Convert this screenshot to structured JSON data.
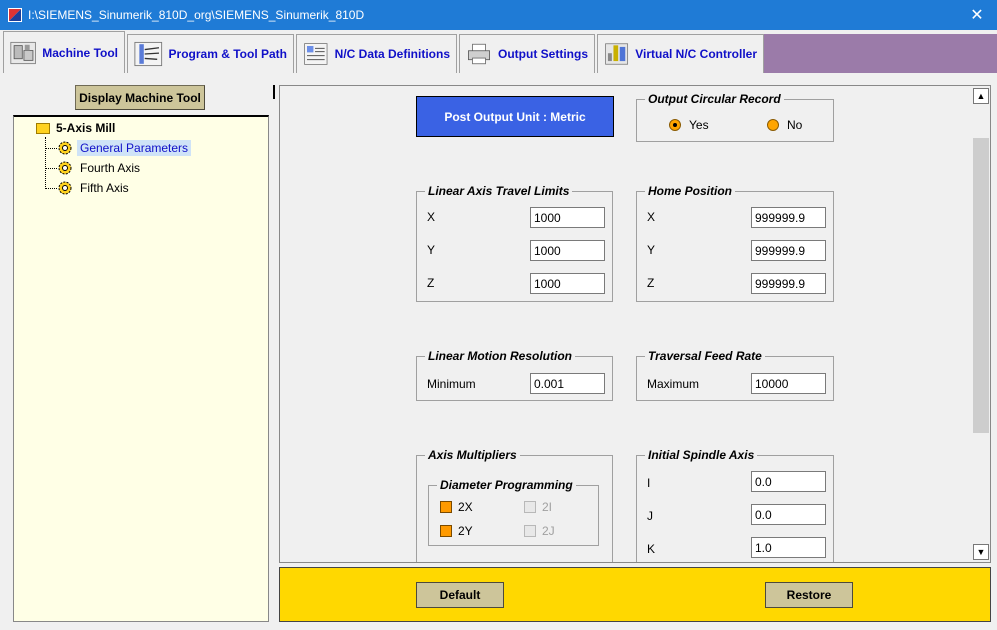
{
  "window": {
    "title": "I:\\SIEMENS_Sinumerik_810D_org\\SIEMENS_Sinumerik_810D",
    "close_label": "✕"
  },
  "tabs": [
    {
      "label": "Machine Tool",
      "icon": "machine-tool-icon",
      "active": true
    },
    {
      "label": "Program & Tool Path",
      "icon": "program-tool-path-icon",
      "active": false
    },
    {
      "label": "N/C Data Definitions",
      "icon": "nc-data-icon",
      "active": false
    },
    {
      "label": "Output Settings",
      "icon": "printer-icon",
      "active": false
    },
    {
      "label": "Virtual N/C Controller",
      "icon": "virtual-controller-icon",
      "active": false
    }
  ],
  "left_panel": {
    "display_button": "Display Machine Tool",
    "tree": {
      "root": "5-Axis Mill",
      "items": [
        {
          "label": "General Parameters",
          "selected": true
        },
        {
          "label": "Fourth Axis",
          "selected": false
        },
        {
          "label": "Fifth Axis",
          "selected": false
        }
      ]
    }
  },
  "main": {
    "post_output_unit": "Post Output Unit : Metric",
    "output_circular_record": {
      "title": "Output Circular Record",
      "options": [
        "Yes",
        "No"
      ],
      "selected": "Yes"
    },
    "linear_axis_travel_limits": {
      "title": "Linear Axis Travel Limits",
      "labels": [
        "X",
        "Y",
        "Z"
      ],
      "values": [
        "1000",
        "1000",
        "1000"
      ]
    },
    "home_position": {
      "title": "Home Position",
      "labels": [
        "X",
        "Y",
        "Z"
      ],
      "values": [
        "999999.9",
        "999999.9",
        "999999.9"
      ]
    },
    "linear_motion_resolution": {
      "title": "Linear Motion Resolution",
      "label": "Minimum",
      "value": "0.001"
    },
    "traversal_feed_rate": {
      "title": "Traversal Feed Rate",
      "label": "Maximum",
      "value": "10000"
    },
    "axis_multipliers": {
      "title": "Axis Multipliers",
      "diameter_programming": {
        "title": "Diameter Programming",
        "options": [
          {
            "label": "2X",
            "checked": true,
            "enabled": true
          },
          {
            "label": "2I",
            "checked": false,
            "enabled": false
          },
          {
            "label": "2Y",
            "checked": true,
            "enabled": true
          },
          {
            "label": "2J",
            "checked": false,
            "enabled": false
          }
        ]
      }
    },
    "initial_spindle_axis": {
      "title": "Initial Spindle Axis",
      "labels": [
        "I",
        "J",
        "K"
      ],
      "values": [
        "0.0",
        "0.0",
        "1.0"
      ]
    }
  },
  "bottom": {
    "default_label": "Default",
    "restore_label": "Restore"
  },
  "colors": {
    "title_bar": "#1f7bd6",
    "tab_label": "#1010c8",
    "tab_filler": "#9b7ba9",
    "tree_bg": "#ffffe6",
    "metric_button": "#3a62e4",
    "bottom_bar": "#ffd800",
    "button_face": "#cdc59a",
    "check_on": "#ff9a00"
  }
}
